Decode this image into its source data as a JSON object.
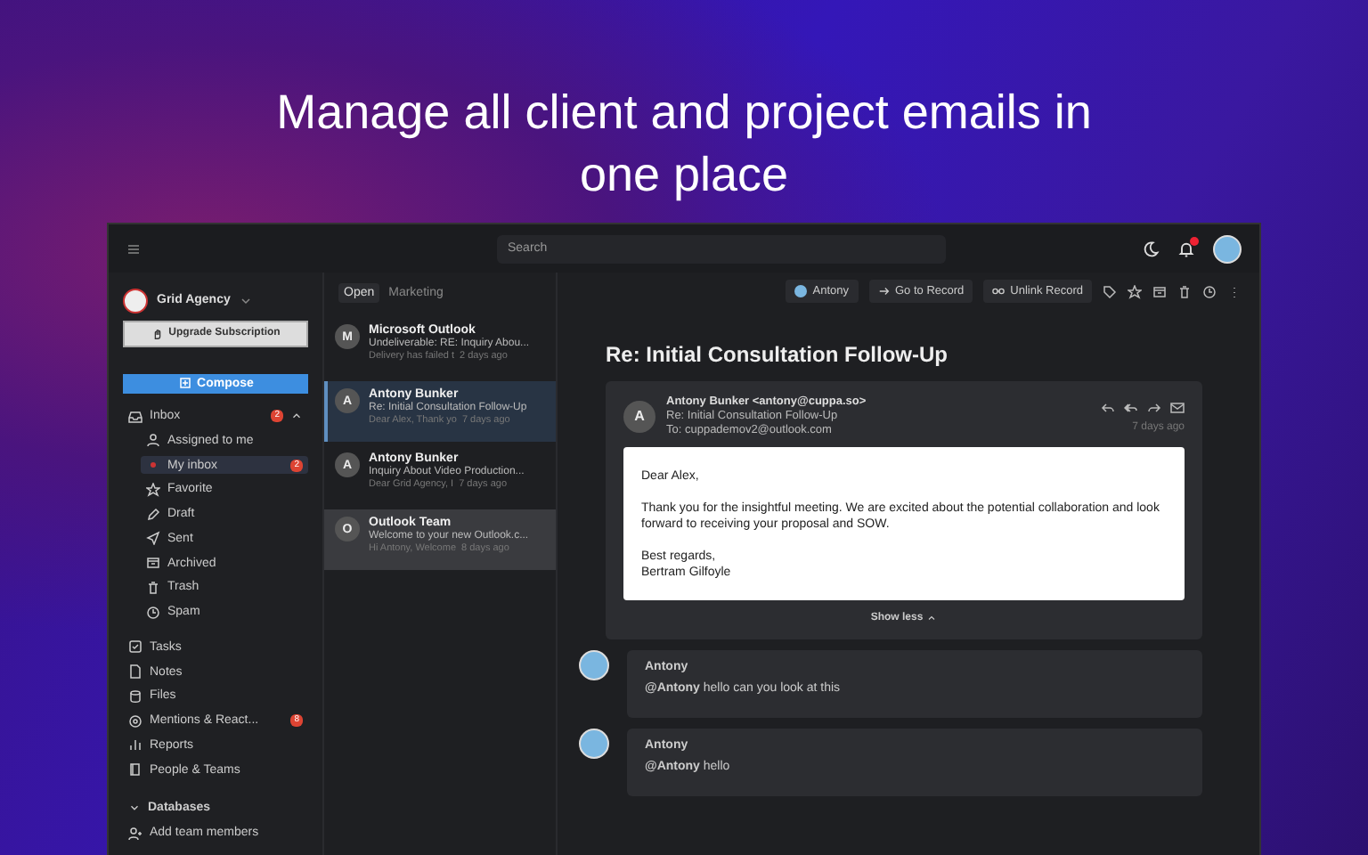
{
  "headline": "Manage all client and project emails in one place",
  "topbar": {
    "search_placeholder": "Search"
  },
  "sidebar": {
    "workspace": "Grid Agency",
    "upgrade_button": "Upgrade Subscription",
    "compose_button": "Compose",
    "inbox": {
      "label": "Inbox",
      "badge": "2",
      "expanded": true,
      "children": [
        {
          "label": "Assigned to me",
          "selected": false
        },
        {
          "label": "My inbox",
          "badge": "2",
          "selected": true
        },
        {
          "label": "Favorite",
          "selected": false
        },
        {
          "label": "Draft",
          "selected": false
        },
        {
          "label": "Sent",
          "selected": false
        },
        {
          "label": "Archived",
          "selected": false
        },
        {
          "label": "Trash",
          "selected": false
        },
        {
          "label": "Spam",
          "selected": false
        }
      ]
    },
    "nav": [
      {
        "label": "Tasks"
      },
      {
        "label": "Notes"
      },
      {
        "label": "Files"
      },
      {
        "label": "Mentions & React...",
        "badge": "8"
      },
      {
        "label": "Reports"
      },
      {
        "label": "People & Teams"
      }
    ],
    "section": {
      "label": "Databases",
      "expanded": true
    },
    "add_members": "Add team members"
  },
  "list_tabs": [
    {
      "label": "Open",
      "selected": true
    },
    {
      "label": "Marketing",
      "selected": false
    }
  ],
  "emails": [
    {
      "letter": "M",
      "sender": "Microsoft Outlook",
      "subject": "Undeliverable: RE: Inquiry Abou...",
      "preview": "Delivery has failed t",
      "time": "2 days ago",
      "selected": false,
      "hovered": false
    },
    {
      "letter": "A",
      "sender": "Antony Bunker",
      "subject": "Re: Initial Consultation Follow-Up",
      "preview": "Dear Alex, Thank yo",
      "time": "7 days ago",
      "selected": true,
      "hovered": false
    },
    {
      "letter": "A",
      "sender": "Antony Bunker",
      "subject": "Inquiry About Video Production...",
      "preview": "Dear Grid Agency, I",
      "time": "7 days ago",
      "selected": false,
      "hovered": false
    },
    {
      "letter": "O",
      "sender": "Outlook Team",
      "subject": "Welcome to your new Outlook.c...",
      "preview": "Hi Antony, Welcome",
      "time": "8 days ago",
      "selected": false,
      "hovered": true
    }
  ],
  "toolbar": {
    "contact": "Antony",
    "buttons": [
      "Go to Record",
      "Unlink Record"
    ]
  },
  "message": {
    "title": "Re: Initial Consultation Follow-Up",
    "letter": "A",
    "from": "Antony Bunker <antony@cuppa.so>",
    "subject": "Re: Initial Consultation Follow-Up",
    "to": "To: cuppademov2@outlook.com",
    "time": "7 days ago",
    "body": [
      "Dear Alex,",
      "Thank you for the insightful meeting. We are excited about the potential collaboration and look forward to receiving your proposal and SOW.",
      "Best regards,\nBertram Gilfoyle"
    ],
    "show_less": "Show less"
  },
  "comments": [
    {
      "author": "Antony",
      "mention": "@Antony",
      "text": "hello can you look at this"
    },
    {
      "author": "Antony",
      "mention": "@Antony",
      "text": "hello"
    }
  ]
}
